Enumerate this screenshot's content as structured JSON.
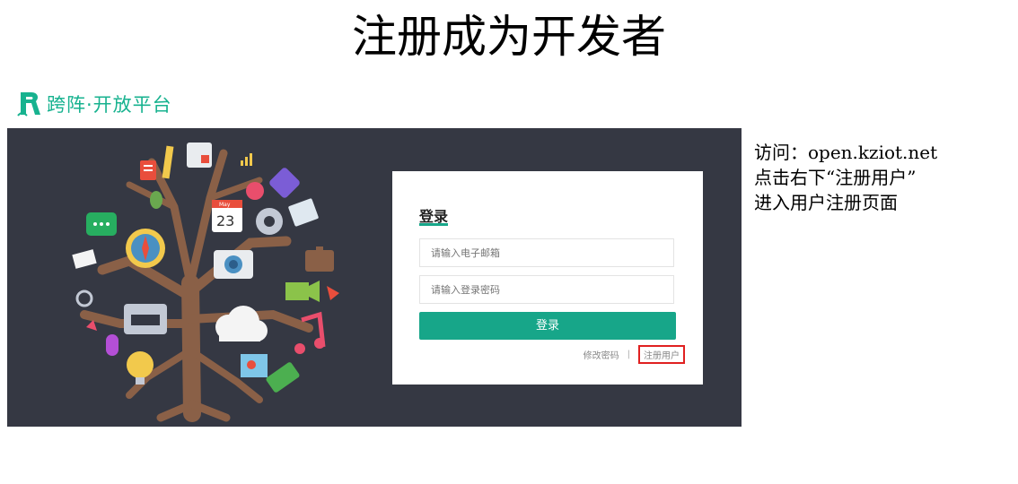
{
  "slide": {
    "title": "注册成为开发者"
  },
  "logo": {
    "text": "跨阵·开放平台"
  },
  "illustration": {
    "calendar_month": "May",
    "calendar_day": "23"
  },
  "login": {
    "title": "登录",
    "email_placeholder": "请输入电子邮箱",
    "password_placeholder": "请输入登录密码",
    "submit_label": "登录",
    "change_password_link": "修改密码",
    "separator": "|",
    "register_link": "注册用户"
  },
  "notes": {
    "lines": [
      "访问：open.kziot.net",
      "点击右下“注册用户”",
      "进入用户注册页面"
    ]
  },
  "colors": {
    "accent": "#17a689",
    "logo": "#17b28f",
    "screen_bg": "#353843",
    "highlight": "#e02020"
  }
}
